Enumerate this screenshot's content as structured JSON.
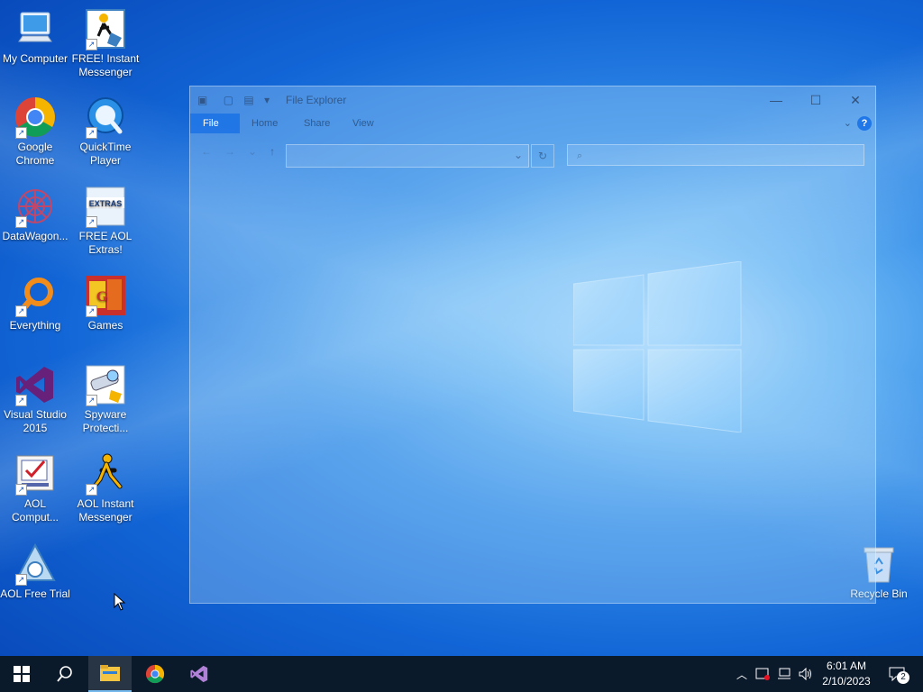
{
  "desktop": {
    "icons": [
      {
        "label": "My Computer",
        "icon": "computer-icon"
      },
      {
        "label": "FREE! Instant Messenger",
        "icon": "messenger-icon"
      },
      {
        "label": "Google Chrome",
        "icon": "chrome-icon"
      },
      {
        "label": "QuickTime Player",
        "icon": "quicktime-icon"
      },
      {
        "label": "DataWagon...",
        "icon": "datawagon-icon"
      },
      {
        "label": "FREE AOL Extras!",
        "icon": "aol-extras-icon",
        "badge": "EXTRAS"
      },
      {
        "label": "Everything",
        "icon": "everything-search-icon"
      },
      {
        "label": "Games",
        "icon": "games-icon"
      },
      {
        "label": "Visual Studio 2015",
        "icon": "visual-studio-icon"
      },
      {
        "label": "Spyware Protecti...",
        "icon": "spyware-icon"
      },
      {
        "label": "AOL Comput...",
        "icon": "aol-computer-icon"
      },
      {
        "label": "AOL Instant Messenger",
        "icon": "aim-icon"
      },
      {
        "label": "AOL Free Trial",
        "icon": "aol-free-trial-icon"
      },
      {
        "label": "Recycle Bin",
        "icon": "recycle-bin-icon"
      }
    ]
  },
  "explorer": {
    "title": "File Explorer",
    "tabs": [
      "File",
      "Home",
      "Share",
      "View"
    ],
    "help": "?"
  },
  "taskbar": {
    "apps": [
      "start-icon",
      "search-icon",
      "file-explorer-icon",
      "chrome-icon",
      "visual-studio-icon"
    ],
    "clock": {
      "time": "6:01 AM",
      "date": "2/10/2023"
    },
    "notification_count": "2"
  },
  "colors": {
    "taskbar": "#0b1a2b",
    "accent": "#1a6fe0"
  }
}
